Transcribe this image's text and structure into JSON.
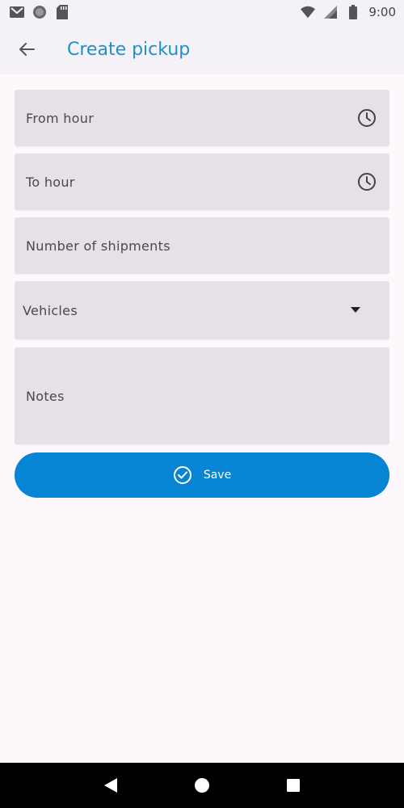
{
  "status_bar": {
    "time": "9:00",
    "icons_left": [
      "gmail-icon",
      "circle-app-icon",
      "sd-card-icon"
    ],
    "icons_right": [
      "wifi-icon",
      "cellular-signal-icon",
      "battery-icon"
    ]
  },
  "app_bar": {
    "title": "Create pickup",
    "back_icon": "arrow-back-icon",
    "title_color": "#1f90c8"
  },
  "form": {
    "from_hour": {
      "placeholder": "From hour",
      "icon": "clock-icon"
    },
    "to_hour": {
      "placeholder": "To hour",
      "icon": "clock-icon"
    },
    "shipments": {
      "placeholder": "Number of shipments"
    },
    "vehicles": {
      "placeholder": "Vehicles",
      "icon": "dropdown-arrow-icon"
    },
    "notes": {
      "placeholder": "Notes"
    }
  },
  "save": {
    "label": "Save",
    "icon": "check-circle-icon",
    "color": "#0784d4"
  },
  "nav_bar": {
    "icons": [
      "back-triangle-icon",
      "home-circle-icon",
      "recents-square-icon"
    ]
  },
  "colors": {
    "field_bg": "#e6e0e9",
    "page_bg": "#fdf8fc",
    "appbar_bg": "#f4f2f7"
  }
}
